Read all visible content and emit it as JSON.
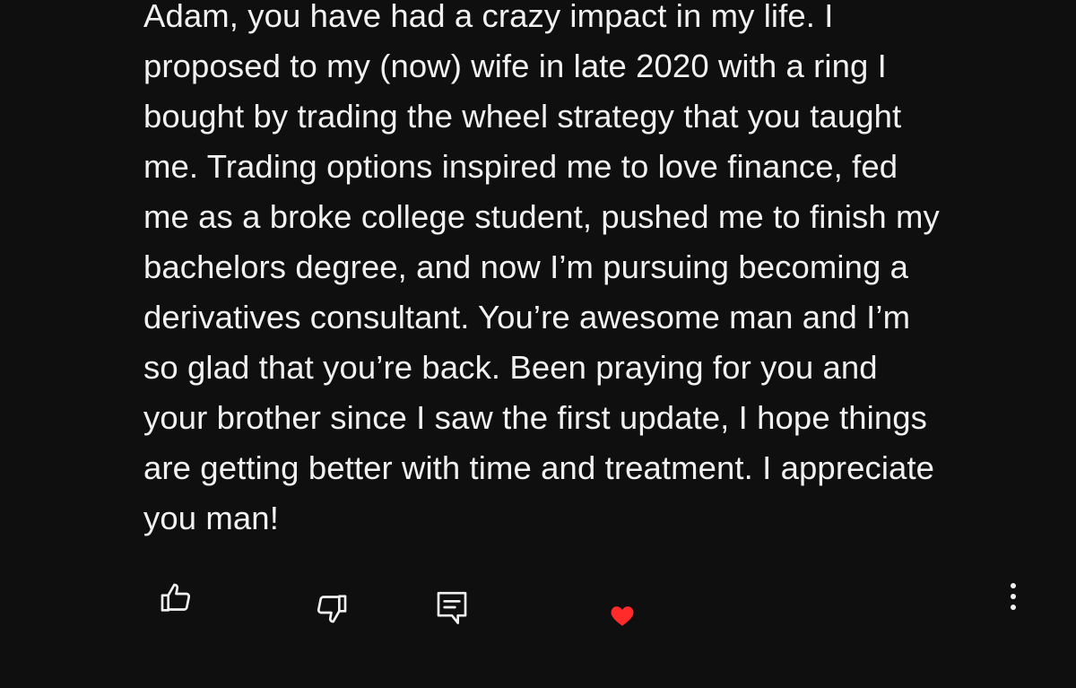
{
  "comment": {
    "lines": [
      "Adam, you have had a crazy impact in my life. I",
      "proposed to my (now) wife in late 2020 with a ring I",
      "bought by trading the wheel strategy that you taught",
      "me. Trading options inspired me to love finance, fed",
      "me as a broke college student, pushed me to finish my",
      "bachelors degree, and now I’m pursuing becoming a",
      "derivatives consultant. You’re awesome man and I’m",
      "so glad that you’re back. Been praying for you and",
      "your brother since I saw the first update, I hope things",
      "are getting better with time and treatment. I appreciate",
      "you man!"
    ]
  },
  "actions": {
    "like_icon": "thumbs-up-icon",
    "dislike_icon": "thumbs-down-icon",
    "reply_icon": "comment-reply-icon",
    "heart_icon": "creator-heart-icon",
    "more_icon": "more-vertical-icon"
  },
  "colors": {
    "background": "#0f0f0f",
    "text": "#f1f1f1",
    "heart": "#ff2b2b"
  }
}
